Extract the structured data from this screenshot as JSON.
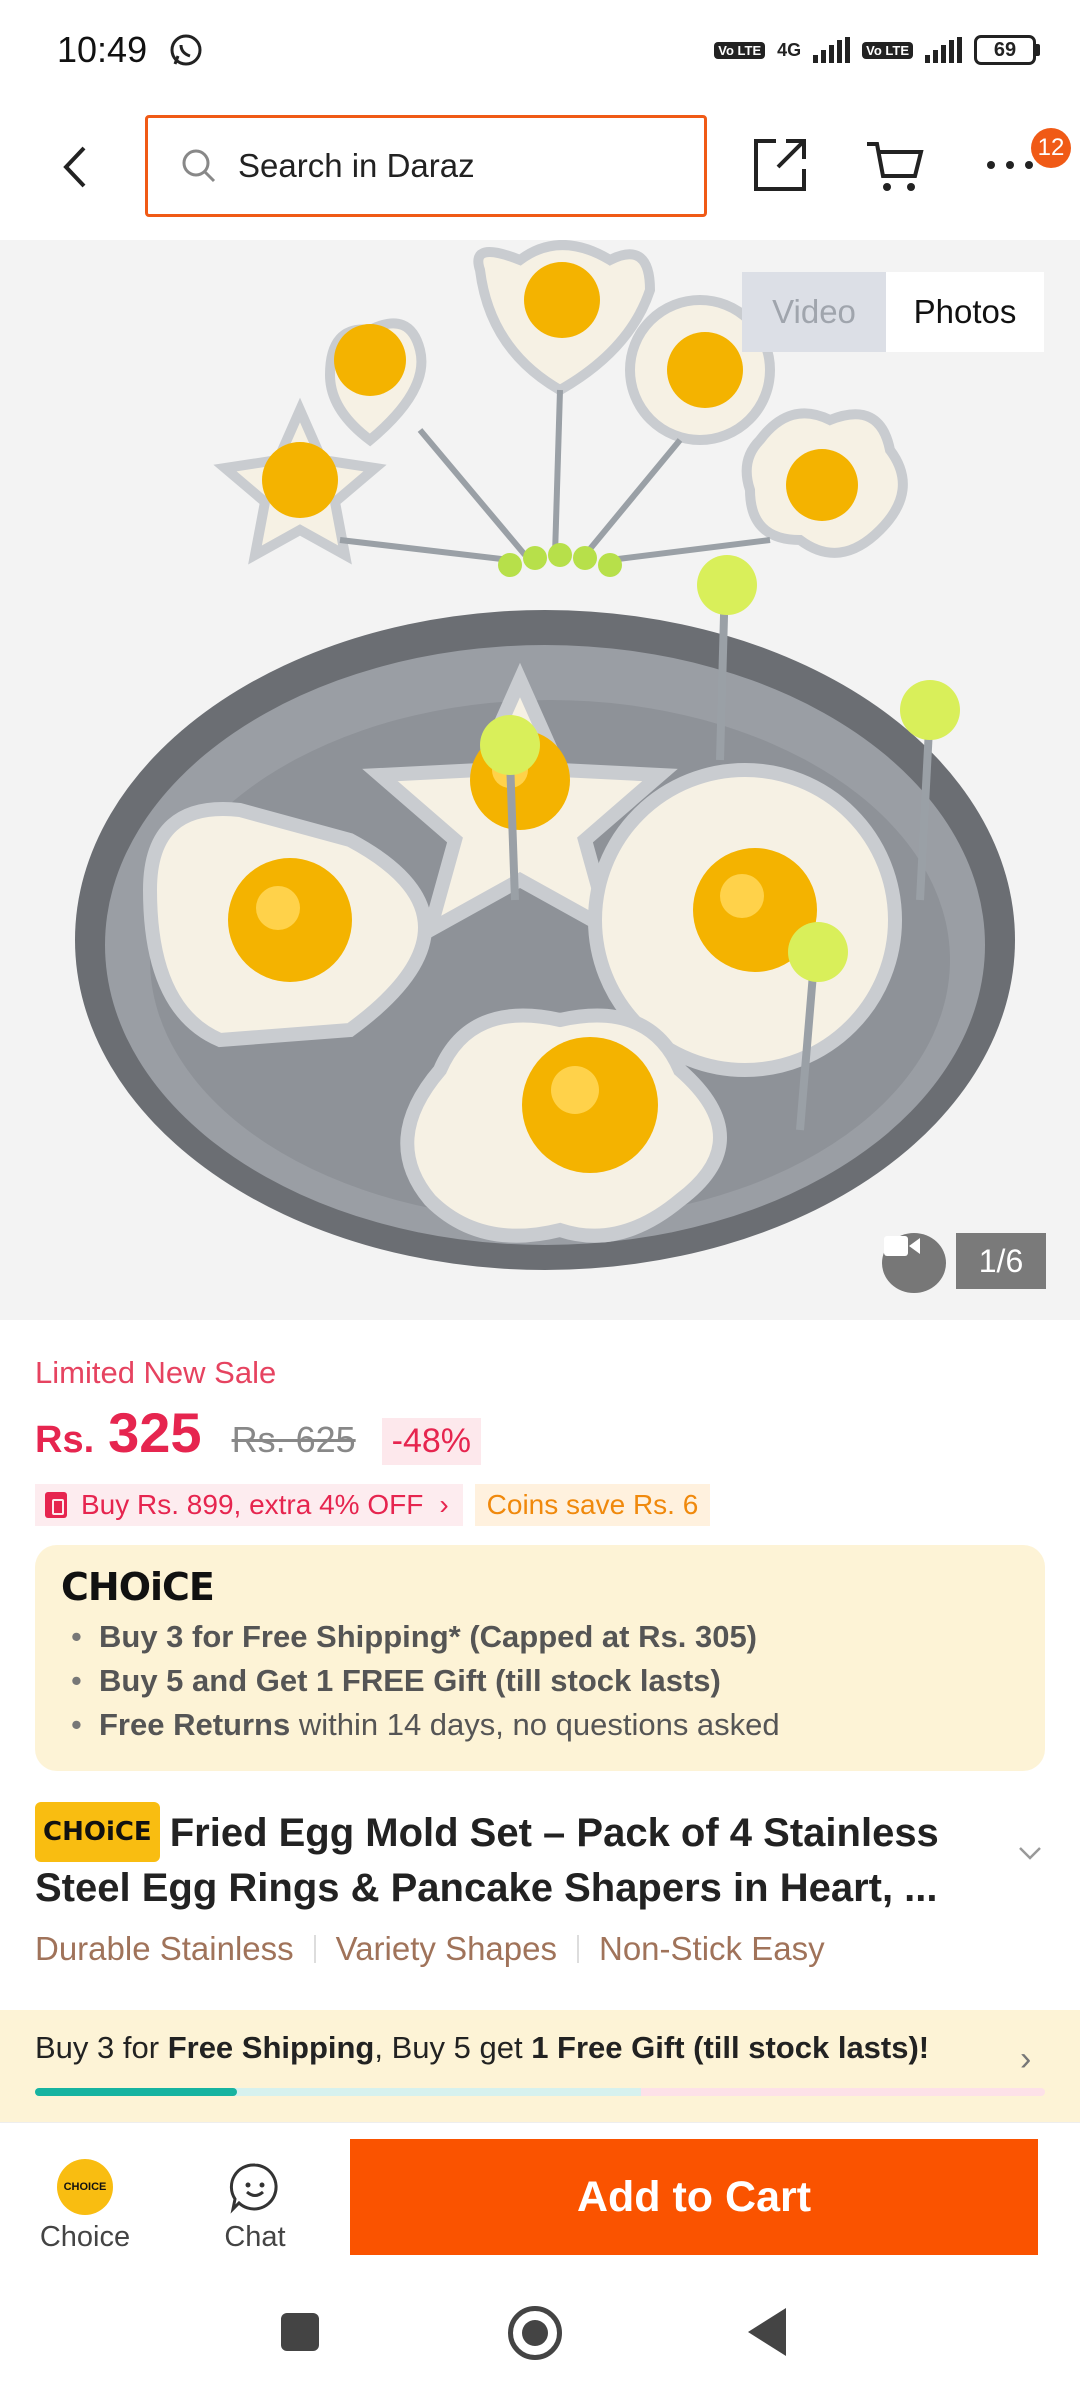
{
  "status_bar": {
    "time": "10:49",
    "network_type": "4G",
    "volte_1": "Vo LTE",
    "volte_2": "Vo LTE",
    "battery": "69"
  },
  "header": {
    "search_placeholder": "Search in Daraz",
    "more_badge_count": "12"
  },
  "gallery": {
    "tab_video": "Video",
    "tab_photos": "Photos",
    "image_counter": "1/6"
  },
  "price": {
    "sale_label": "Limited New Sale",
    "currency": "Rs.",
    "current": "325",
    "original": "Rs. 625",
    "discount": "-48%"
  },
  "promos": {
    "voucher": "Buy Rs. 899, extra 4% OFF",
    "coins": "Coins save Rs. 6"
  },
  "choice": {
    "logo": "CHOiCE",
    "benefits": [
      {
        "bold": "Buy 3 for  Free Shipping* (Capped at Rs. 305)",
        "rest": ""
      },
      {
        "bold": "Buy 5 and Get 1 FREE Gift (till stock lasts)",
        "rest": ""
      },
      {
        "bold": "Free Returns",
        "rest": " within 14 days, no questions asked"
      }
    ]
  },
  "product": {
    "choice_tag": "CHOiCE",
    "title": "Fried Egg Mold Set – Pack of 4 Stainless Steel Egg Rings & Pancake Shapers in Heart, ...",
    "features": [
      "Durable Stainless",
      "Variety Shapes",
      "Non-Stick Easy"
    ]
  },
  "shipping_banner": {
    "part1": "Buy 3 for ",
    "bold1": "Free Shipping",
    "part2": ", Buy 5 get ",
    "bold2": "1 Free Gift (till stock lasts)!",
    "progress_fraction": 0.2
  },
  "action_bar": {
    "choice_label": "Choice",
    "choice_logo": "CHOICE",
    "chat_label": "Chat",
    "add_to_cart": "Add to Cart"
  },
  "colors": {
    "brand_orange": "#fa5300",
    "price_red": "#e6254f",
    "choice_yellow": "#f9bd11",
    "progress_teal": "#17b3a0"
  }
}
